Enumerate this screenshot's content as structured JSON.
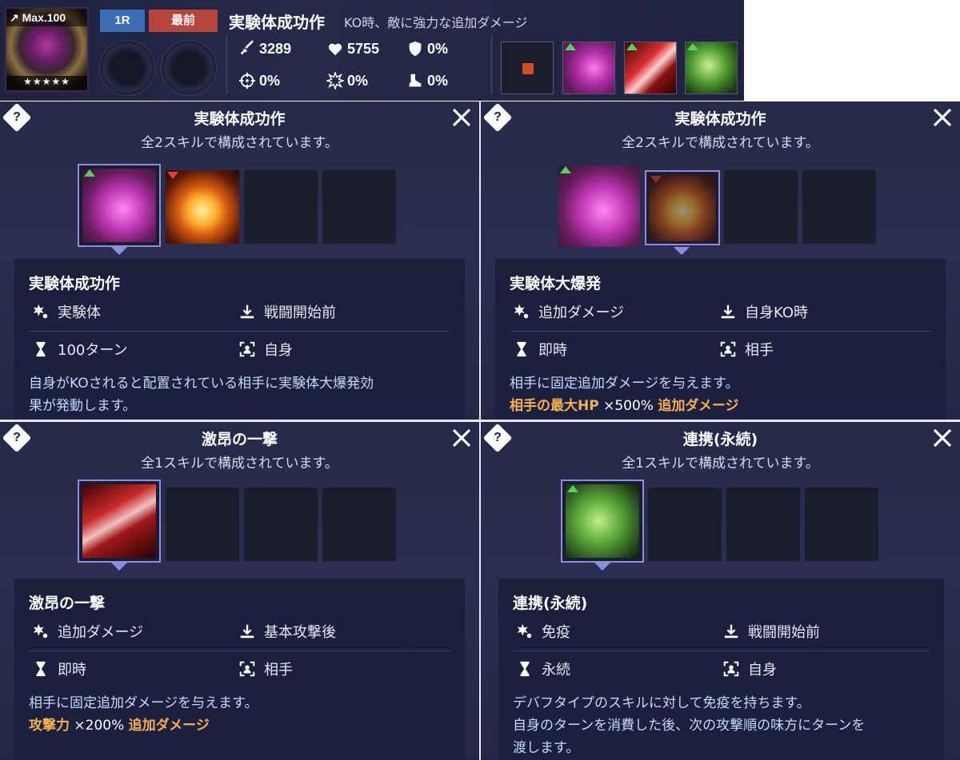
{
  "header": {
    "level_label": "Max.100",
    "stars": "★★★★★",
    "round_badge": "1R",
    "position_badge": "最前",
    "character_name": "実験体成功作",
    "character_desc": "KO時、敵に強力な追加ダメージ",
    "stats": {
      "attack": "3289",
      "hp": "5755",
      "defense": "0%",
      "accuracy": "0%",
      "critical": "0%",
      "evasion": "0%"
    },
    "colors": {
      "round_badge": "#3a6fb8",
      "position_badge": "#b8453c"
    }
  },
  "panels": [
    {
      "title": "実験体成功作",
      "subtitle": "全2スキルで構成されています。",
      "skill_name": "実験体成功作",
      "type": "実験体",
      "trigger": "戦闘開始前",
      "duration": "100ターン",
      "target": "自身",
      "desc_line1": "自身がKOされると配置されている相手に実験体大爆発効",
      "desc_line2": "果が発動します。"
    },
    {
      "title": "実験体成功作",
      "subtitle": "全2スキルで構成されています。",
      "skill_name": "実験体大爆発",
      "type": "追加ダメージ",
      "trigger": "自身KO時",
      "duration": "即時",
      "target": "相手",
      "desc_line1": "相手に固定追加ダメージを与えます。",
      "hl1": "相手の最大HP",
      "mult": " ×500% ",
      "hl2": "追加ダメージ"
    },
    {
      "title": "激昂の一撃",
      "subtitle": "全1スキルで構成されています。",
      "skill_name": "激昂の一撃",
      "type": "追加ダメージ",
      "trigger": "基本攻撃後",
      "duration": "即時",
      "target": "相手",
      "desc_line1": "相手に固定追加ダメージを与えます。",
      "hl1": "攻撃力",
      "mult": " ×200% ",
      "hl2": "追加ダメージ"
    },
    {
      "title": "連携(永続)",
      "subtitle": "全1スキルで構成されています。",
      "skill_name": "連携(永続)",
      "type": "免疫",
      "trigger": "戦闘開始前",
      "duration": "永続",
      "target": "自身",
      "desc_line1": "デバフタイプのスキルに対して免疫を持ちます。",
      "desc_line2": "自身のターンを消費した後、次の攻撃順の味方にターンを",
      "desc_line3": "渡します。"
    }
  ],
  "help_glyph": "?",
  "accent_colors": {
    "highlight": "#f7b04a",
    "selection_border": "#8d8ee0",
    "desc_text": "#c6d8ff"
  }
}
